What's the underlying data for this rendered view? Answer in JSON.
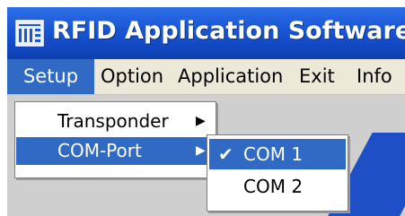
{
  "window": {
    "title": "RFID Application Software"
  },
  "menubar": {
    "items": [
      {
        "label": "Setup",
        "active": true
      },
      {
        "label": "Option",
        "active": false
      },
      {
        "label": "Application",
        "active": false
      },
      {
        "label": "Exit",
        "active": false
      },
      {
        "label": "Info",
        "active": false
      }
    ]
  },
  "setup_menu": {
    "items": [
      {
        "label": "Transponder",
        "has_submenu": true,
        "arrow": "▶",
        "highlighted": false
      },
      {
        "label": "COM-Port",
        "has_submenu": true,
        "arrow": "▶",
        "highlighted": true
      }
    ]
  },
  "com_port_submenu": {
    "items": [
      {
        "label": "COM 1",
        "checked": true,
        "check": "✔",
        "highlighted": true
      },
      {
        "label": "COM 2",
        "checked": false,
        "highlighted": false
      }
    ]
  },
  "icons": {
    "app": "rfid-app-icon",
    "submenu_arrow": "chevron-right-icon",
    "check": "checkmark-icon"
  },
  "colors": {
    "titlebar": "#1a57d6",
    "highlight": "#316ac5",
    "menubar": "#ece9d8"
  }
}
